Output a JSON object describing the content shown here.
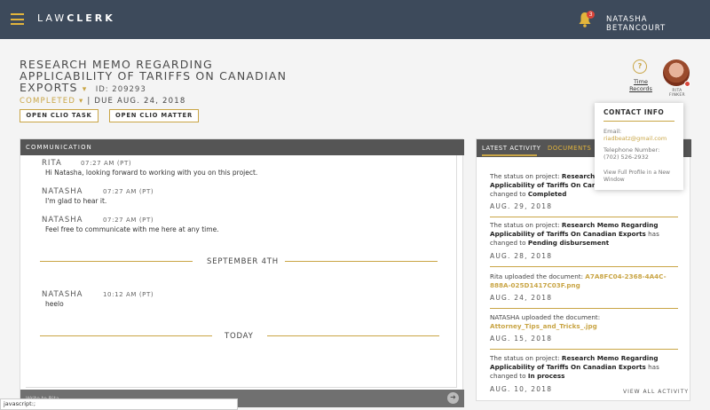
{
  "app": {
    "logo_light": "LAW",
    "logo_bold": "CLERK",
    "user": "NATASHA BETANCOURT",
    "notifications": "3"
  },
  "project": {
    "title": "RESEARCH MEMO REGARDING APPLICABILITY OF TARIFFS ON CANADIAN EXPORTS",
    "caret": "▾",
    "id": "ID: 209293",
    "status": "COMPLETED",
    "status_caret": "▾",
    "due": "| DUE AUG. 24, 2018",
    "btn_task": "OPEN CLIO TASK",
    "btn_matter": "OPEN CLIO MATTER"
  },
  "time_records": {
    "icon": "clock-icon",
    "label": "Time Records"
  },
  "avatar_name": "RITA FINKER",
  "contact": {
    "title": "CONTACT INFO",
    "email_label": "Email:",
    "email": "riadbeatz@gmail.com",
    "phone_label": "Telephone Number:",
    "phone": "(702) 526-2932",
    "profile_link": "View Full Profile in a New Window"
  },
  "communication": {
    "header": "COMMUNICATION",
    "messages": [
      {
        "name": "RITA",
        "time": "07:27 AM (PT)",
        "text": "Hi Natasha, looking forward to working with you on this project."
      },
      {
        "name": "NATASHA",
        "time": "07:27 AM (PT)",
        "text": "I'm glad to hear it."
      },
      {
        "name": "NATASHA",
        "time": "07:27 AM (PT)",
        "text": "Feel free to communicate with me here at any time."
      },
      {
        "name": "NATASHA",
        "time": "10:12 AM (PT)",
        "text": "heelo"
      }
    ],
    "divider1": "SEPTEMBER 4TH",
    "divider2": "TODAY",
    "compose_placeholder": "Write to Rita",
    "send_icon": "send-icon"
  },
  "activity": {
    "tab_latest": "LATEST ACTIVITY",
    "tab_documents": "DOCUMENTS",
    "items": [
      {
        "pre": "The status on project: ",
        "bold": "Research Memo Regarding Applicability of Tariffs On Canadian Exports",
        "mid": " has changed to ",
        "end": "Completed",
        "date": "AUG. 29, 2018"
      },
      {
        "pre": "The status on project: ",
        "bold": "Research Memo Regarding Applicability of Tariffs On Canadian Exports",
        "mid": " has changed to ",
        "end": "Pending disbursement",
        "date": "AUG. 28, 2018"
      },
      {
        "pre": "Rita uploaded the document: ",
        "link": "A7A8FC04-2368-4A4C-888A-025D1417C03F.png",
        "date": "AUG. 24, 2018"
      },
      {
        "pre": "NATASHA uploaded the document: ",
        "link": "Attorney_Tips_and_Tricks_.jpg",
        "date": "AUG. 15, 2018"
      },
      {
        "pre": "The status on project: ",
        "bold": "Research Memo Regarding Applicability of Tariffs On Canadian Exports",
        "mid": " has changed to ",
        "end": "In process",
        "date": "AUG. 10, 2018"
      }
    ],
    "view_all": "VIEW ALL ACTIVITY"
  },
  "statusbar": "javascript:;"
}
